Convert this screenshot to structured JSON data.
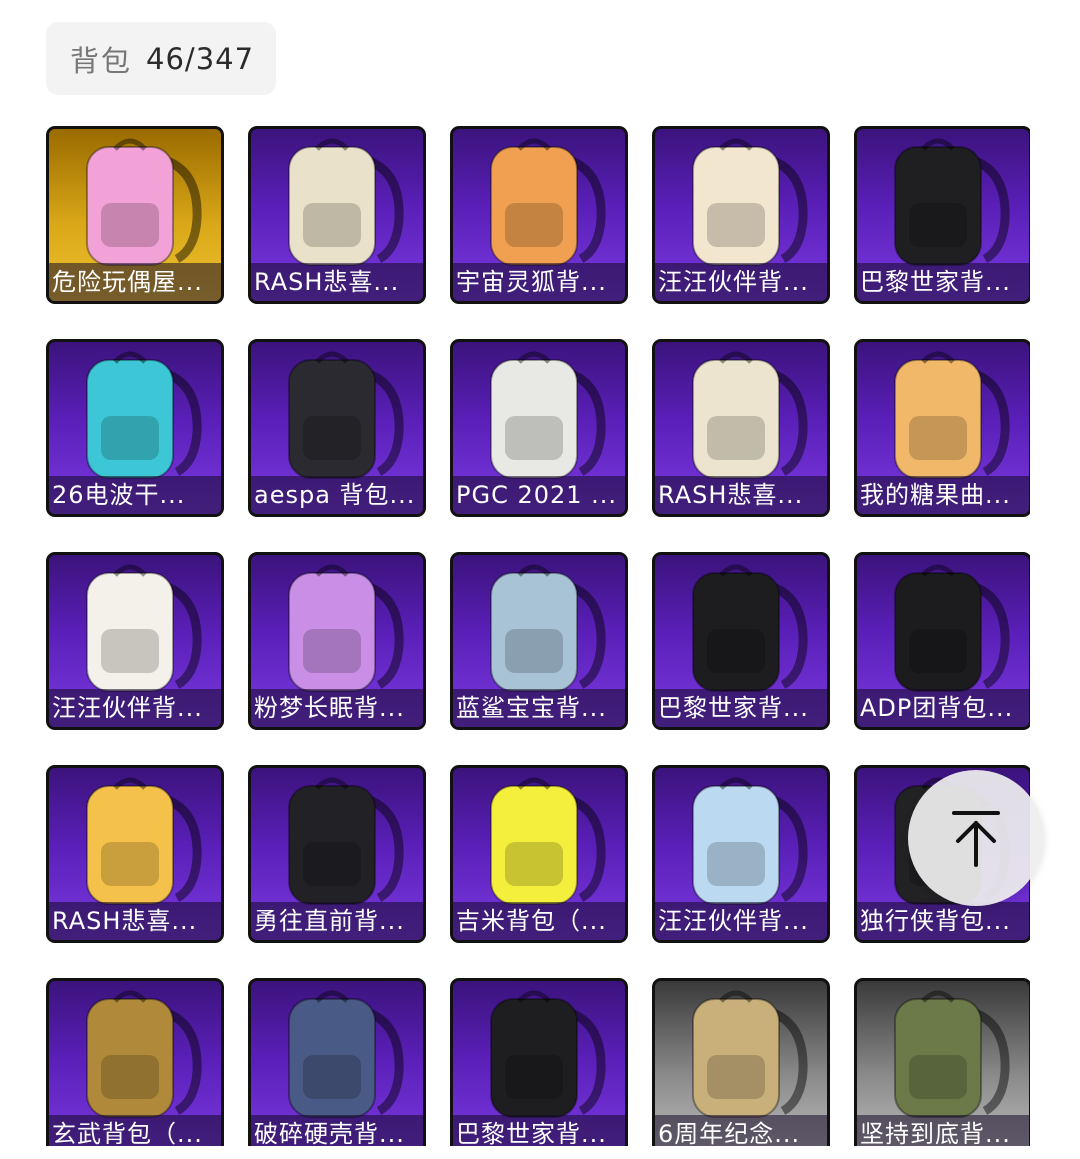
{
  "header": {
    "label": "背包",
    "count": "46/347"
  },
  "items": [
    {
      "name": "危险玩偶屋...",
      "bg": "gold",
      "color": "#f2a2d6"
    },
    {
      "name": "RASH悲喜...",
      "bg": "purple",
      "color": "#e9e1c9"
    },
    {
      "name": "宇宙灵狐背...",
      "bg": "purple",
      "color": "#f0a050"
    },
    {
      "name": "汪汪伙伴背...",
      "bg": "purple",
      "color": "#f2e6cf"
    },
    {
      "name": "巴黎世家背...",
      "bg": "purple",
      "color": "#1f1f22"
    },
    {
      "name": "26电波干...",
      "bg": "purple",
      "color": "#3dc6d6"
    },
    {
      "name": "aespa 背包...",
      "bg": "purple",
      "color": "#2a2a30"
    },
    {
      "name": "PGC 2021 ...",
      "bg": "purple",
      "color": "#e8e8e4"
    },
    {
      "name": "RASH悲喜...",
      "bg": "purple",
      "color": "#ece4cf"
    },
    {
      "name": "我的糖果曲...",
      "bg": "purple",
      "color": "#f2b86a"
    },
    {
      "name": "汪汪伙伴背...",
      "bg": "purple",
      "color": "#f4f1ea"
    },
    {
      "name": "粉梦长眠背...",
      "bg": "purple",
      "color": "#c98fe6"
    },
    {
      "name": "蓝鲨宝宝背...",
      "bg": "purple",
      "color": "#a9c3d6"
    },
    {
      "name": "巴黎世家背...",
      "bg": "purple",
      "color": "#1d1d20"
    },
    {
      "name": "ADP团背包...",
      "bg": "purple",
      "color": "#1c1c1f"
    },
    {
      "name": "RASH悲喜...",
      "bg": "purple",
      "color": "#f4c24a"
    },
    {
      "name": "勇往直前背...",
      "bg": "purple",
      "color": "#222226"
    },
    {
      "name": "吉米背包（...",
      "bg": "purple",
      "color": "#f4ee3c"
    },
    {
      "name": "汪汪伙伴背...",
      "bg": "purple",
      "color": "#bcd9f2"
    },
    {
      "name": "独行侠背包...",
      "bg": "purple",
      "color": "#222225"
    },
    {
      "name": "玄武背包（...",
      "bg": "purple",
      "color": "#b08a3a"
    },
    {
      "name": "破碎硬壳背...",
      "bg": "purple",
      "color": "#4a5a86"
    },
    {
      "name": "巴黎世家背...",
      "bg": "purple",
      "color": "#1e1e21"
    },
    {
      "name": "6周年纪念...",
      "bg": "gray",
      "color": "#c9b07a"
    },
    {
      "name": "坚持到底背...",
      "bg": "gray",
      "color": "#6c7a4a"
    }
  ],
  "scroll_top": {
    "icon": "arrow-up-to-top-icon"
  }
}
